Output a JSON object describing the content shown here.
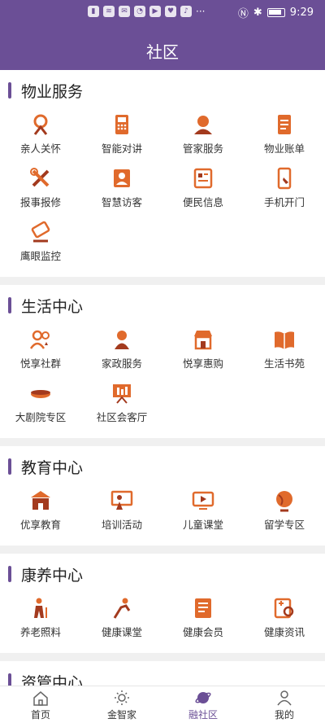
{
  "status_bar": {
    "time": "9:29"
  },
  "header": {
    "title": "社区"
  },
  "colors": {
    "accent": "#6b4f96",
    "icon_orange": "#e06a2c",
    "icon_dark": "#a33a1e"
  },
  "sections": [
    {
      "title": "物业服务",
      "items": [
        {
          "label": "亲人关怀",
          "icon": "care-icon"
        },
        {
          "label": "智能对讲",
          "icon": "intercom-icon"
        },
        {
          "label": "管家服务",
          "icon": "butler-icon"
        },
        {
          "label": "物业账单",
          "icon": "bill-icon"
        },
        {
          "label": "报事报修",
          "icon": "repair-icon"
        },
        {
          "label": "智慧访客",
          "icon": "visitor-icon"
        },
        {
          "label": "便民信息",
          "icon": "info-icon"
        },
        {
          "label": "手机开门",
          "icon": "phone-door-icon"
        },
        {
          "label": "鹰眼监控",
          "icon": "camera-icon"
        }
      ]
    },
    {
      "title": "生活中心",
      "items": [
        {
          "label": "悦享社群",
          "icon": "community-icon"
        },
        {
          "label": "家政服务",
          "icon": "housekeeping-icon"
        },
        {
          "label": "悦享惠购",
          "icon": "shop-icon"
        },
        {
          "label": "生活书苑",
          "icon": "book-icon"
        },
        {
          "label": "大剧院专区",
          "icon": "theater-icon"
        },
        {
          "label": "社区会客厅",
          "icon": "lounge-icon"
        }
      ]
    },
    {
      "title": "教育中心",
      "items": [
        {
          "label": "优享教育",
          "icon": "school-icon"
        },
        {
          "label": "培训活动",
          "icon": "training-icon"
        },
        {
          "label": "儿童课堂",
          "icon": "video-class-icon"
        },
        {
          "label": "留学专区",
          "icon": "globe-icon"
        }
      ]
    },
    {
      "title": "康养中心",
      "items": [
        {
          "label": "养老照料",
          "icon": "elderly-icon"
        },
        {
          "label": "健康课堂",
          "icon": "exercise-icon"
        },
        {
          "label": "健康会员",
          "icon": "member-icon"
        },
        {
          "label": "健康资讯",
          "icon": "health-news-icon"
        }
      ]
    },
    {
      "title": "资管中心",
      "items": []
    }
  ],
  "tabbar": [
    {
      "label": "首页",
      "icon": "home-icon",
      "active": false
    },
    {
      "label": "金智家",
      "icon": "bulb-icon",
      "active": false
    },
    {
      "label": "融社区",
      "icon": "planet-icon",
      "active": true
    },
    {
      "label": "我的",
      "icon": "user-icon",
      "active": false
    }
  ]
}
